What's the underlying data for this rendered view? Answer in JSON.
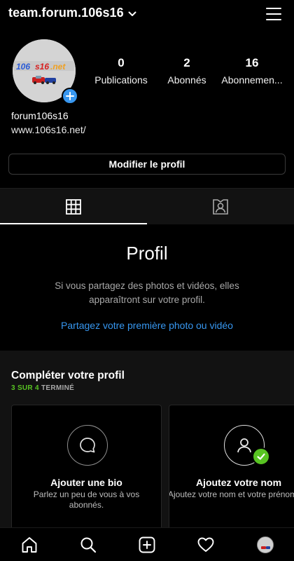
{
  "header": {
    "username": "team.forum.106s16",
    "dropdown_icon": "chevron-down-icon",
    "menu_icon": "hamburger-menu-icon"
  },
  "profile": {
    "avatar_logo_text": "106 s16.net",
    "stats": [
      {
        "value": "0",
        "label": "Publications"
      },
      {
        "value": "2",
        "label": "Abonnés"
      },
      {
        "value": "16",
        "label": "Abonnemen..."
      }
    ],
    "display_name": "forum106s16",
    "website": "www.106s16.net/",
    "edit_button": "Modifier le profil"
  },
  "tabs": [
    {
      "icon": "grid-icon",
      "active": true
    },
    {
      "icon": "tagged-person-icon",
      "active": false
    }
  ],
  "empty_state": {
    "title": "Profil",
    "description": "Si vous partagez des photos et vidéos, elles apparaîtront sur votre profil.",
    "link": "Partagez votre première photo ou vidéo"
  },
  "complete_profile": {
    "title": "Compléter votre profil",
    "progress_done": "3 SUR 4",
    "progress_rest": " TERMINÉ",
    "cards": [
      {
        "title": "Ajouter une bio",
        "description": "Parlez un peu de vous à vos abonnés.",
        "icon": "speech-bubble-icon",
        "completed": false
      },
      {
        "title": "Ajoutez votre nom",
        "description": "Ajoutez votre nom et votre prénom pour que vos amis",
        "icon": "person-icon",
        "completed": true
      }
    ]
  },
  "bottom_nav": [
    {
      "icon": "home-icon"
    },
    {
      "icon": "search-icon"
    },
    {
      "icon": "new-post-icon"
    },
    {
      "icon": "heart-icon"
    },
    {
      "icon": "profile-avatar-icon"
    }
  ],
  "colors": {
    "accent_blue": "#3797f0",
    "success_green": "#58c322",
    "background": "#000000",
    "surface": "#121212"
  }
}
